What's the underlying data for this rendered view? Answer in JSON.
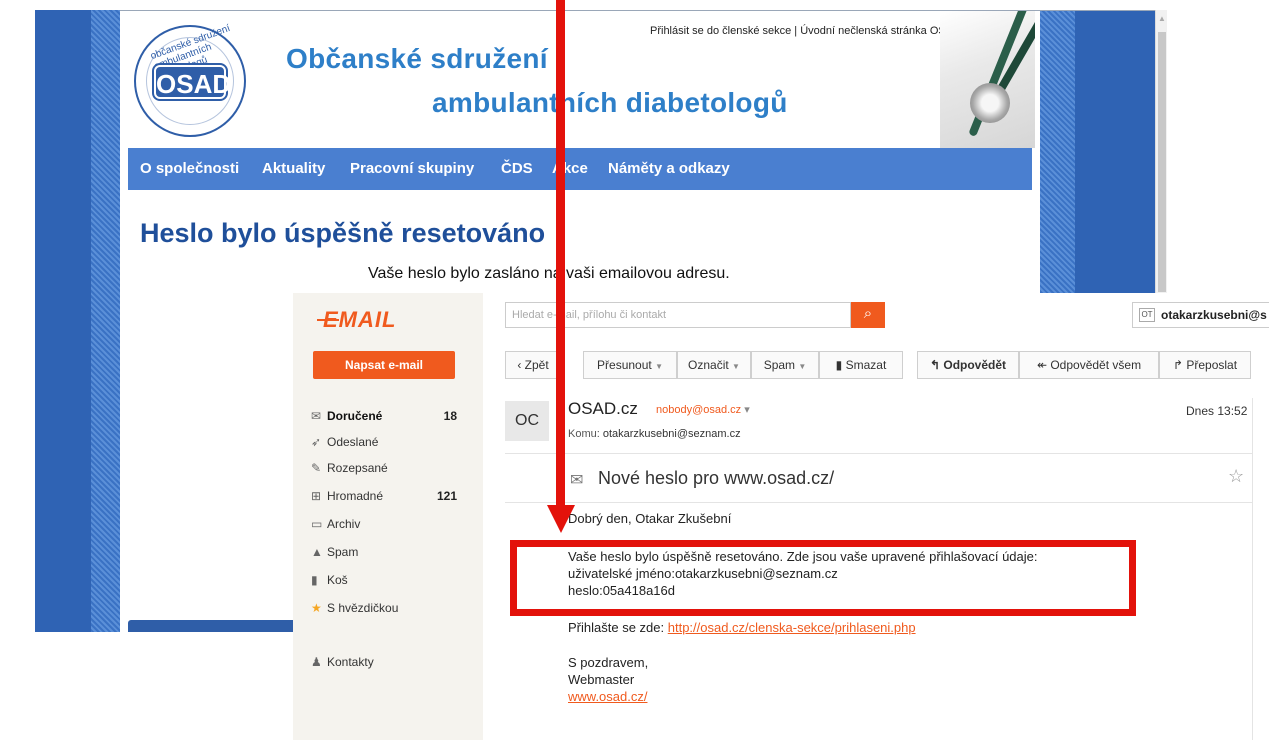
{
  "website": {
    "top_links": "Přihlásit se do členské sekce | Úvodní nečlenská stránka OSAD.cz",
    "logo": {
      "mark": "OSAD",
      "arc_text": "občanské sdružení ambulantních diabetologů"
    },
    "title_line1": "Občanské sdružení",
    "title_line2": "ambulantních diabetologů",
    "nav": [
      "O společnosti",
      "Aktuality",
      "Pracovní skupiny",
      "ČDS",
      "Akce",
      "Náměty a odkazy"
    ],
    "heading": "Heslo bylo úspěšně resetováno",
    "message": "Vaše heslo bylo zasláno na vaši emailovou adresu."
  },
  "email": {
    "logo": "EMAIL",
    "compose_label": "Napsat e-mail",
    "search_placeholder": "Hledat e-mail, přílohu či kontakt",
    "user": {
      "initials": "OT",
      "name": "otakarzkusebni@s"
    },
    "folders": [
      {
        "label": "Doručené",
        "count": "18",
        "icon": "inbox-icon"
      },
      {
        "label": "Odeslané",
        "count": "",
        "icon": "sent-icon"
      },
      {
        "label": "Rozepsané",
        "count": "",
        "icon": "drafts-icon"
      },
      {
        "label": "Hromadné",
        "count": "121",
        "icon": "cart-icon"
      },
      {
        "label": "Archiv",
        "count": "",
        "icon": "archive-icon"
      },
      {
        "label": "Spam",
        "count": "",
        "icon": "warning-icon"
      },
      {
        "label": "Koš",
        "count": "",
        "icon": "trash-icon"
      },
      {
        "label": "S hvězdičkou",
        "count": "",
        "icon": "star-icon"
      },
      {
        "label": "Kontakty",
        "count": "",
        "icon": "contacts-icon"
      }
    ],
    "toolbar": {
      "back": "Zpět",
      "move": "Přesunout",
      "mark": "Označit",
      "spam": "Spam",
      "delete": "Smazat",
      "reply": "Odpovědět",
      "reply_all": "Odpovědět všem",
      "forward": "Přeposlat"
    },
    "message": {
      "avatar": "OC",
      "from_name": "OSAD.cz",
      "from_email": "nobody@osad.cz",
      "to_label": "Komu:",
      "to": "otakarzkusebni@seznam.cz",
      "date": "Dnes 13:52",
      "subject": "Nové heslo pro www.osad.cz/",
      "greeting": "Dobrý den, Otakar Zkušební",
      "line1": "Vaše heslo bylo úspěšně resetováno. Zde jsou vaše upravené přihlašovací údaje:",
      "line2": "uživatelské jméno:otakarzkusebni@seznam.cz",
      "line3": "heslo:05a418a16d",
      "login_prefix": "Přihlašte se zde:",
      "login_link": "http://osad.cz/clenska-sekce/prihlaseni.php",
      "closing1": "S pozdravem,",
      "closing2": "Webmaster",
      "site_link": "www.osad.cz/"
    }
  },
  "colors": {
    "accent": "#f05a1e",
    "site_blue": "#4a7fd0",
    "title_blue": "#2e7fc8",
    "annotation_red": "#e3120b"
  }
}
